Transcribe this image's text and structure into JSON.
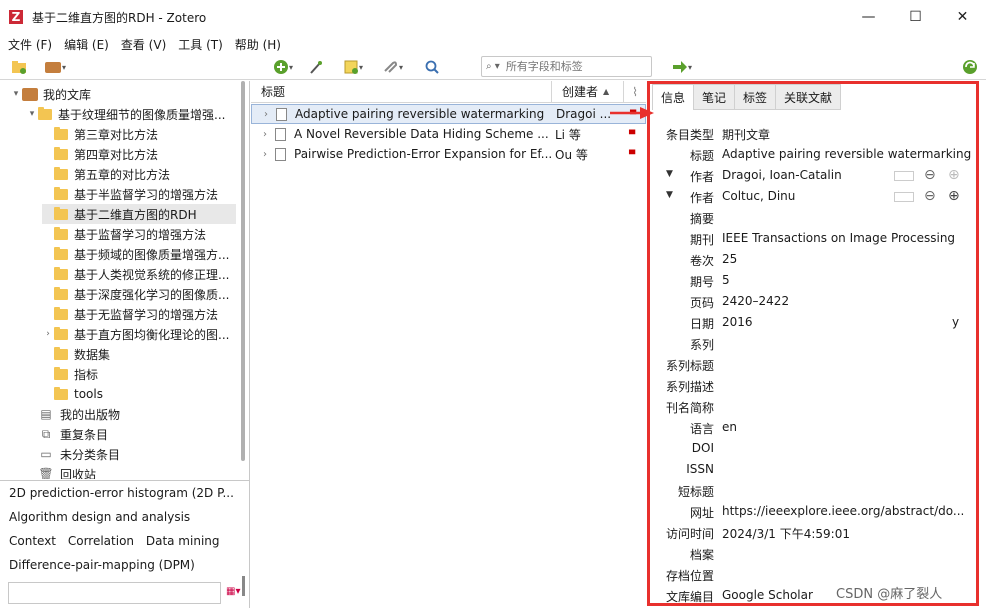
{
  "window": {
    "title": "基于二维直方图的RDH - Zotero"
  },
  "menu": [
    "文件 (F)",
    "编辑 (E)",
    "查看 (V)",
    "工具 (T)",
    "帮助 (H)"
  ],
  "search": {
    "placeholder": "所有字段和标签"
  },
  "collections": [
    {
      "label": "我的文库",
      "level": 0,
      "twisty": "▾",
      "icon": "library"
    },
    {
      "label": "基于纹理细节的图像质量增强...",
      "level": 1,
      "twisty": "▾",
      "icon": "folder"
    },
    {
      "label": "第三章对比方法",
      "level": 2,
      "twisty": "",
      "icon": "folder"
    },
    {
      "label": "第四章对比方法",
      "level": 2,
      "twisty": "",
      "icon": "folder"
    },
    {
      "label": "第五章的对比方法",
      "level": 2,
      "twisty": "",
      "icon": "folder"
    },
    {
      "label": "基于半监督学习的增强方法",
      "level": 2,
      "twisty": "",
      "icon": "folder"
    },
    {
      "label": "基于二维直方图的RDH",
      "level": 2,
      "twisty": "",
      "icon": "folder",
      "selected": true
    },
    {
      "label": "基于监督学习的增强方法",
      "level": 2,
      "twisty": "",
      "icon": "folder"
    },
    {
      "label": "基于频域的图像质量增强方...",
      "level": 2,
      "twisty": "",
      "icon": "folder"
    },
    {
      "label": "基于人类视觉系统的修正理...",
      "level": 2,
      "twisty": "",
      "icon": "folder"
    },
    {
      "label": "基于深度强化学习的图像质...",
      "level": 2,
      "twisty": "",
      "icon": "folder"
    },
    {
      "label": "基于无监督学习的增强方法",
      "level": 2,
      "twisty": "",
      "icon": "folder"
    },
    {
      "label": "基于直方图均衡化理论的图...",
      "level": 2,
      "twisty": "›",
      "icon": "folder"
    },
    {
      "label": "数据集",
      "level": 2,
      "twisty": "",
      "icon": "folder"
    },
    {
      "label": "指标",
      "level": 2,
      "twisty": "",
      "icon": "folder"
    },
    {
      "label": "tools",
      "level": 2,
      "twisty": "",
      "icon": "folder"
    },
    {
      "label": "我的出版物",
      "level": 1,
      "twisty": "",
      "icon": "doc"
    },
    {
      "label": "重复条目",
      "level": 1,
      "twisty": "",
      "icon": "dup"
    },
    {
      "label": "未分类条目",
      "level": 1,
      "twisty": "",
      "icon": "unfiled"
    },
    {
      "label": "回收站",
      "level": 1,
      "twisty": "",
      "icon": "trash"
    }
  ],
  "tags": [
    "2D prediction-error histogram (2D P...",
    "Algorithm design and analysis",
    "Context",
    "Correlation",
    "Data mining",
    "Difference-pair-mapping (DPM)"
  ],
  "columns": {
    "title": "标题",
    "creator": "创建者"
  },
  "items": [
    {
      "title": "Adaptive pairing reversible watermarking",
      "creator": "Dragoi ...",
      "selected": true
    },
    {
      "title": "A Novel Reversible Data Hiding Scheme ...",
      "creator": "Li 等"
    },
    {
      "title": "Pairwise Prediction-Error Expansion for Ef...",
      "creator": "Ou 等"
    }
  ],
  "tabs": [
    "信息",
    "笔记",
    "标签",
    "关联文献"
  ],
  "fields": [
    {
      "label": "条目类型",
      "value": "期刊文章"
    },
    {
      "label": "标题",
      "value": "Adaptive pairing reversible watermarking"
    },
    {
      "label": "作者",
      "value": "Dragoi, Ioan-Catalin",
      "creator": true
    },
    {
      "label": "作者",
      "value": "Coltuc, Dinu",
      "creator": true
    },
    {
      "label": "摘要",
      "value": ""
    },
    {
      "label": "期刊",
      "value": "IEEE Transactions on Image Processing"
    },
    {
      "label": "卷次",
      "value": "25"
    },
    {
      "label": "期号",
      "value": "5"
    },
    {
      "label": "页码",
      "value": "2420–2422"
    },
    {
      "label": "日期",
      "value": "2016",
      "suffix": "y"
    },
    {
      "label": "系列",
      "value": ""
    },
    {
      "label": "系列标题",
      "value": ""
    },
    {
      "label": "系列描述",
      "value": ""
    },
    {
      "label": "刊名简称",
      "value": ""
    },
    {
      "label": "语言",
      "value": "en"
    },
    {
      "label": "DOI",
      "value": ""
    },
    {
      "label": "ISSN",
      "value": ""
    },
    {
      "label": "短标题",
      "value": ""
    },
    {
      "label": "网址",
      "value": "https://ieeexplore.ieee.org/abstract/do..."
    },
    {
      "label": "访问时间",
      "value": "2024/3/1 下午4:59:01"
    },
    {
      "label": "档案",
      "value": ""
    },
    {
      "label": "存档位置",
      "value": ""
    },
    {
      "label": "文库编目",
      "value": "Google Scholar"
    }
  ],
  "watermark": "CSDN @麻了裂人"
}
